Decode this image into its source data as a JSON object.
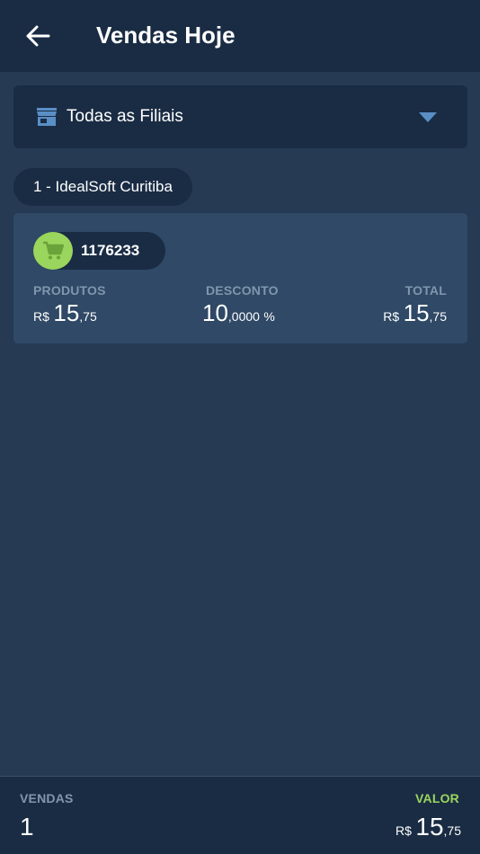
{
  "header": {
    "title": "Vendas Hoje",
    "back_icon": "arrow-left-icon"
  },
  "branch_filter": {
    "icon": "store-icon",
    "label": "Todas as Filiais",
    "arrow_icon": "chevron-down-icon"
  },
  "branch_chip": {
    "label": "1 - IdealSoft Curitiba"
  },
  "sales": [
    {
      "icon": "cart-icon",
      "id": "1176233",
      "produtos": {
        "label": "PRODUTOS",
        "currency": "R$",
        "int": "15",
        "dec": ",75"
      },
      "desconto": {
        "label": "DESCONTO",
        "int": "10",
        "dec": ",0000",
        "unit": "%"
      },
      "total": {
        "label": "TOTAL",
        "currency": "R$",
        "int": "15",
        "dec": ",75"
      }
    }
  ],
  "footer": {
    "vendas_label": "VENDAS",
    "vendas_count": "1",
    "valor_label": "VALOR",
    "valor": {
      "currency": "R$",
      "int": "15",
      "dec": ",75"
    }
  },
  "colors": {
    "appbar": "#1a2c44",
    "background": "#263a54",
    "card": "#2f4966",
    "accent_green": "#9ad55d",
    "muted_label": "#8196ad",
    "arrow_blue": "#5a8fc6"
  }
}
